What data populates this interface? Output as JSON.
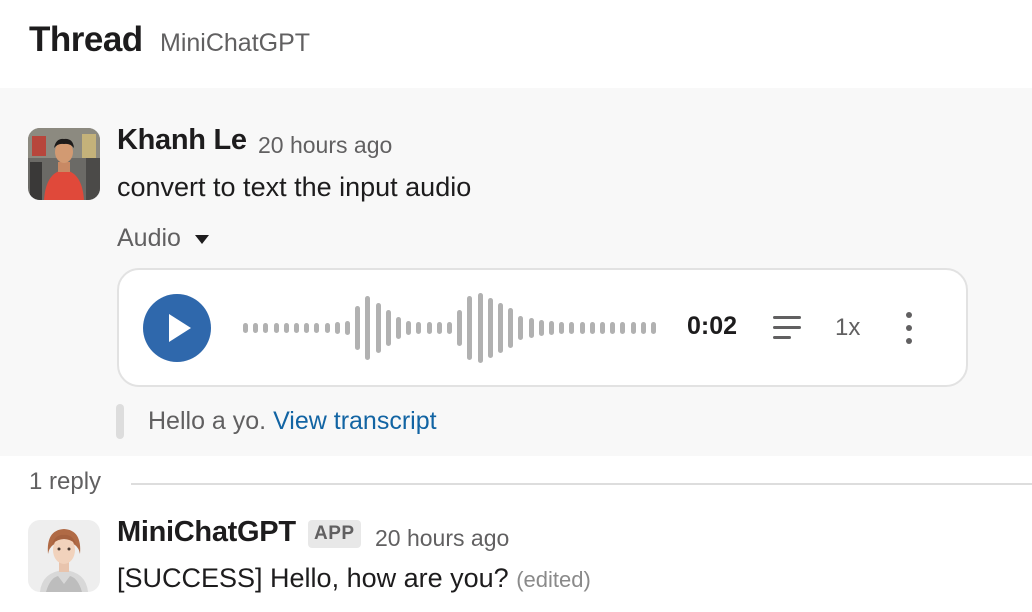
{
  "header": {
    "title": "Thread",
    "channel": "MiniChatGPT"
  },
  "parent_message": {
    "author": "Khanh Le",
    "time": "20 hours ago",
    "text": "convert to text the input audio",
    "attachment_label": "Audio",
    "player": {
      "duration": "0:02",
      "speed": "1x",
      "state": "paused"
    },
    "transcript": {
      "preview": "Hello a yo.",
      "link": "View transcript"
    }
  },
  "replies": {
    "count_label": "1 reply",
    "items": [
      {
        "author": "MiniChatGPT",
        "badge": "APP",
        "time": "20 hours ago",
        "text": "[SUCCESS] Hello, how are you?",
        "edited": "(edited)"
      }
    ]
  },
  "colors": {
    "accent": "#2f68ac",
    "link": "#1264a3",
    "muted": "#616061",
    "highlight_bg": "#f8f8f8"
  },
  "icons": [
    "play-icon",
    "caret-down-icon",
    "transcript-icon",
    "more-vertical-icon"
  ]
}
